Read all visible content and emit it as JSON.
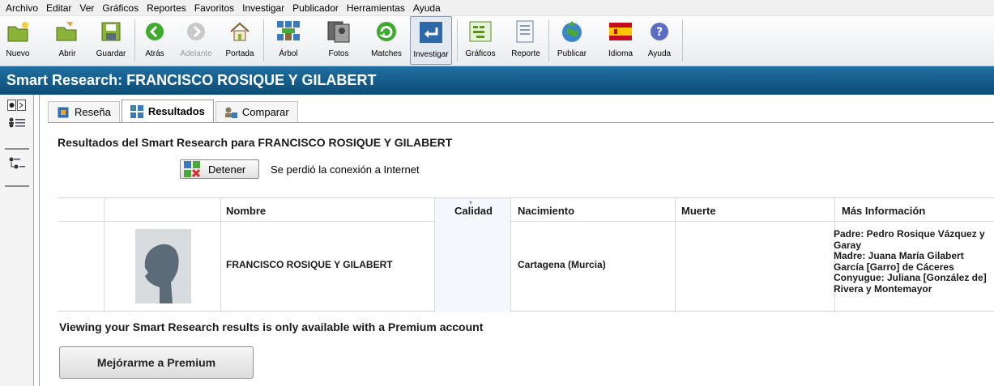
{
  "menu": [
    "Archivo",
    "Editar",
    "Ver",
    "Gráficos",
    "Reportes",
    "Favoritos",
    "Investigar",
    "Publicador",
    "Herramientas",
    "Ayuda"
  ],
  "toolbar": {
    "nuevo": "Nuevo",
    "abrir": "Abrir",
    "guardar": "Guardar",
    "atras": "Atrás",
    "adelante": "Adelante",
    "portada": "Portada",
    "arbol": "Árbol",
    "fotos": "Fotos",
    "matches": "Matches",
    "investigar": "Investigar",
    "graficos": "Gráficos",
    "reporte": "Reporte",
    "publicar": "Publicar",
    "idioma": "Idioma",
    "ayuda": "Ayuda"
  },
  "title": "Smart Research: FRANCISCO ROSIQUE Y GILABERT",
  "tabs": {
    "resena": "Reseña",
    "resultados": "Resultados",
    "comparar": "Comparar"
  },
  "main": {
    "heading": "Resultados del Smart Research para FRANCISCO ROSIQUE Y GILABERT",
    "stop_button": "Detener",
    "status": "Se perdió la conexión a Internet"
  },
  "table": {
    "headers": {
      "nombre": "Nombre",
      "calidad": "Calidad",
      "nacimiento": "Nacimiento",
      "muerte": "Muerte",
      "mas_info": "Más Información"
    },
    "row": {
      "nombre": "FRANCISCO ROSIQUE Y GILABERT",
      "calidad": "",
      "nacimiento": "Cartagena (Murcia)",
      "muerte": "",
      "mas_info": [
        "Padre: Pedro Rosique Vázquez y Garay",
        "Madre: Juana María Gilabert García [Garro] de Cáceres",
        "Conyugue: Juliana [González de] Rivera y Montemayor"
      ]
    }
  },
  "premium": {
    "message": "Viewing your Smart Research results is only available with a Premium account",
    "button": "Mejórarme a Premium"
  }
}
